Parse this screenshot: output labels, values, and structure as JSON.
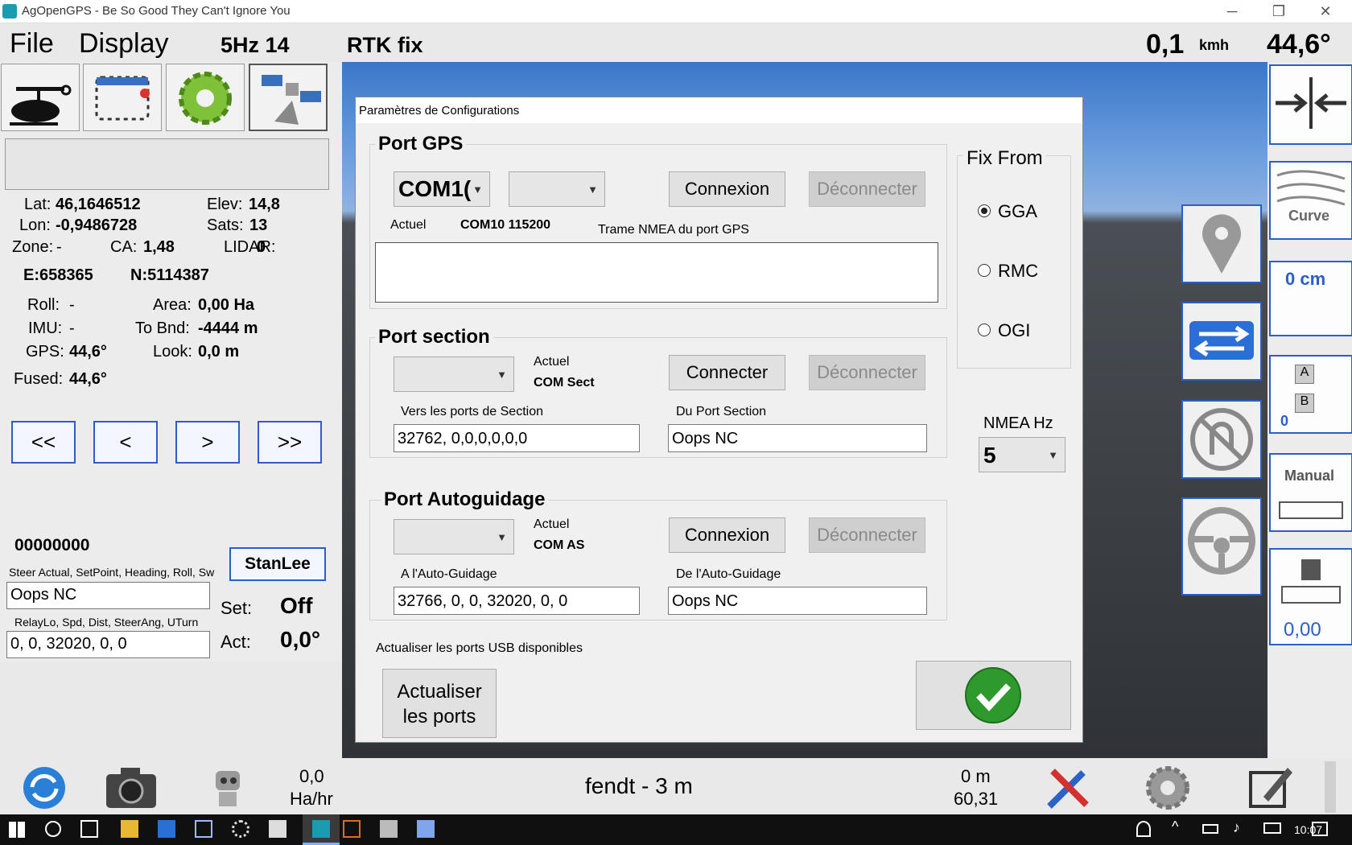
{
  "window": {
    "title": "AgOpenGPS - Be So Good They Can't Ignore You",
    "min": "─",
    "max": "❐",
    "close": "✕"
  },
  "menu": {
    "file": "File",
    "display": "Display",
    "rate": "5Hz 14",
    "fix": "RTK fix",
    "speed": "0,1",
    "speed_unit": "kmh",
    "heading": "44,6°"
  },
  "gps_info": {
    "lat_label": "Lat:",
    "lat": "46,1646512",
    "elev_label": "Elev:",
    "elev": "14,8",
    "lon_label": "Lon:",
    "lon": "-0,9486728",
    "sats_label": "Sats:",
    "sats": "13",
    "zone_label": "Zone:",
    "zone": "-",
    "ca_label": "CA:",
    "ca": "1,48",
    "lidar_label": "LIDAR:",
    "lidar": "0",
    "easting": "E:658365",
    "northing": "N:5114387",
    "roll_label": "Roll:",
    "roll": "-",
    "area_label": "Area:",
    "area": "0,00 Ha",
    "imu_label": "IMU:",
    "imu": "-",
    "tobnd_label": "To Bnd:",
    "tobnd": "-4444 m",
    "gps_label": "GPS:",
    "gps": "44,6°",
    "look_label": "Look:",
    "look": "0,0 m",
    "fused_label": "Fused:",
    "fused": "44,6°"
  },
  "nav": {
    "first": "<<",
    "prev": "<",
    "next": ">",
    "last": ">>"
  },
  "steer": {
    "code": "00000000",
    "stanlee": "StanLee",
    "header1": "Steer Actual, SetPoint, Heading, Roll, Sw",
    "box1": "Oops NC",
    "header2": "RelayLo, Spd, Dist, SteerAng, UTurn",
    "box2": "0, 0, 32020, 0, 0",
    "set_label": "Set:",
    "set_value": "Off",
    "act_label": "Act:",
    "act_value": "0,0°"
  },
  "dialog": {
    "title": "Paramètres de Configurations",
    "gps": {
      "title": "Port GPS",
      "port": "COM1(",
      "baud": "",
      "connect": "Connexion",
      "disconnect": "Déconnecter",
      "actual_label": "Actuel",
      "actual_value": "COM10 115200",
      "nmea_label": "Trame NMEA du port GPS",
      "nmea": ""
    },
    "section": {
      "title": "Port section",
      "port": "",
      "actual_label": "Actuel",
      "actual_value": "COM Sect",
      "connect": "Connecter",
      "disconnect": "Déconnecter",
      "to_label": "Vers les ports de Section",
      "to_value": "32762, 0,0,0,0,0,0",
      "from_label": "Du Port Section",
      "from_value": "Oops NC"
    },
    "autosteer": {
      "title": "Port Autoguidage",
      "port": "",
      "actual_label": "Actuel",
      "actual_value": "COM AS",
      "connect": "Connexion",
      "disconnect": "Déconnecter",
      "to_label": "A l'Auto-Guidage",
      "to_value": "32766, 0, 0, 32020, 0, 0",
      "from_label": "De l'Auto-Guidage",
      "from_value": "Oops NC"
    },
    "fix_from": {
      "title": "Fix From",
      "options": [
        "GGA",
        "RMC",
        "OGI"
      ],
      "selected": "GGA"
    },
    "nmea_hz": {
      "label": "NMEA Hz",
      "value": "5"
    },
    "refresh_label": "Actualiser les ports USB disponibles",
    "refresh_button": "Actualiser\nles ports"
  },
  "right": {
    "curve": "Curve",
    "offset": "0 cm",
    "ab_value": "0",
    "manual": "Manual",
    "tram": "0,00"
  },
  "bottom": {
    "rate": "0,0",
    "rate_unit": "Ha/hr",
    "vehicle": "fendt - 3 m",
    "dist": "0 m",
    "dist2": "60,31"
  },
  "taskbar": {
    "time": "10:07"
  },
  "colors": {
    "accent_blue": "#2b5fc7",
    "ok_green": "#2e9a2e"
  }
}
